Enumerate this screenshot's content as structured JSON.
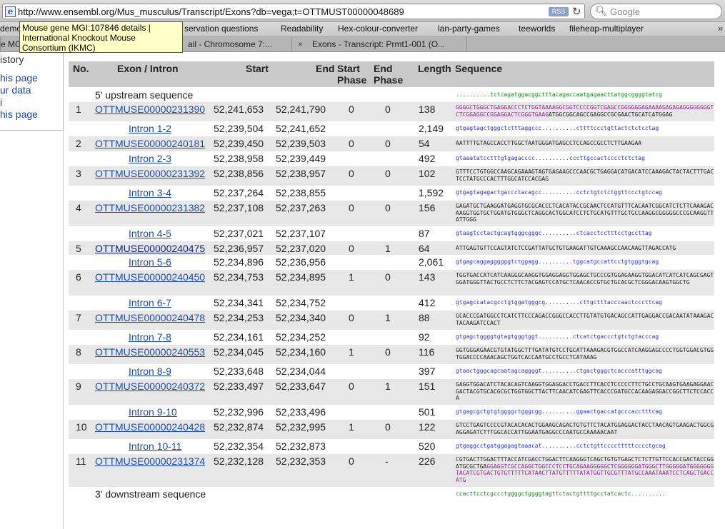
{
  "browser": {
    "url": "http://www.ensembl.org/Mus_musculus/Transcript/Exons?db=vega;t=OTTMUST00000048689",
    "rss_label": "RSS",
    "search_placeholder": "Google"
  },
  "bookmarks": [
    {
      "label": "demo"
    },
    {
      "label": "servation questions"
    },
    {
      "label": "Readability"
    },
    {
      "label": "Hex-colour-converter"
    },
    {
      "label": "lan-party-games"
    },
    {
      "label": "teeworlds"
    },
    {
      "label": "fileheap-multiplayer"
    }
  ],
  "tabs": [
    {
      "label": "e MG"
    },
    {
      "label": "ail - Chromosome 7:..."
    },
    {
      "label": "Exons - Transcript: Prmt1-001 (O..."
    }
  ],
  "tooltip": "Mouse gene MGI:107846 details | International Knockout Mouse Consortium (IKMC)",
  "sidebar": {
    "items": [
      "istory",
      "his page",
      "ur data",
      "his page"
    ]
  },
  "table": {
    "headers": {
      "no": "No.",
      "exon": "Exon / Intron",
      "start": "Start",
      "end": "End",
      "start_phase": "Start Phase",
      "end_phase": "End Phase",
      "length": "Length",
      "sequence": "Sequence"
    },
    "rows": [
      {
        "type": "flank",
        "label": "5' upstream sequence",
        "seq": [
          {
            "c": "gr",
            "t": "..........tctcagatggacggctttacagaccaatgagaacttatggcggggtatcg"
          }
        ]
      },
      {
        "type": "exon",
        "no": "1",
        "id": "OTTMUSE00000231390",
        "start": "52,241,653",
        "end": "52,241,790",
        "sp": "0",
        "ep": "0",
        "len": "138",
        "seq": [
          {
            "c": "pu",
            "t": "GGGGCTGGGCTGAGGACCCTCTGGTAAAAGGCGGTCCCCGGTCGAGCCGGGGGGAGAAAAGAGAGAGGGGGGGGTCTCGGAGGCCGGAGGACTCGGGTGAAG"
          },
          {
            "c": "bk",
            "t": "ATGGCGGCAGCCGAGGCCGCGAACTGCATCATGGAG"
          }
        ]
      },
      {
        "type": "intron",
        "label": "Intron 1-2",
        "start": "52,239,504",
        "end": "52,241,652",
        "len": "2,149",
        "seq": [
          {
            "c": "b",
            "t": "gtgagtagctgggctctttaggccc..........cttttccctgttactctctcctag"
          }
        ]
      },
      {
        "type": "exon",
        "no": "2",
        "id": "OTTMUSE00000240181",
        "start": "52,239,450",
        "end": "52,239,503",
        "sp": "0",
        "ep": "0",
        "len": "54",
        "seq": [
          {
            "c": "bk",
            "t": "AATTTTGTAGCCACCTTGGCTAATGGGATGAGCCTCCAGCCGCCTCTTGAAGAA"
          }
        ]
      },
      {
        "type": "intron",
        "label": "Intron 2-3",
        "start": "52,238,958",
        "end": "52,239,449",
        "len": "492",
        "seq": [
          {
            "c": "b",
            "t": "gtaaatatcctttgtgagacccc..........cccttgccactcccctctctag"
          }
        ]
      },
      {
        "type": "exon",
        "no": "3",
        "id": "OTTMUSE00000231392",
        "start": "52,238,856",
        "end": "52,238,957",
        "sp": "0",
        "ep": "0",
        "len": "102",
        "seq": [
          {
            "c": "bk",
            "t": "GTTTCCTGTGGCCAAGCAGAAAGTAGTGAGAAGCCCAACGCTGAGGACATGACATCCAAAGACTACTACTTTGACTCCTATGCCCACTTTGGCATCCACGAG"
          }
        ]
      },
      {
        "type": "intron",
        "label": "Intron 3-4",
        "start": "52,237,264",
        "end": "52,238,855",
        "len": "1,592",
        "seq": [
          {
            "c": "b",
            "t": "gtgagtagagactgaccctacagcc..........cctctgtctctggttccctgtccag"
          }
        ]
      },
      {
        "type": "exon",
        "no": "4",
        "id": "OTTMUSE00000231382",
        "start": "52,237,108",
        "end": "52,237,263",
        "sp": "0",
        "ep": "0",
        "len": "156",
        "seq": [
          {
            "c": "bk",
            "t": "GAGATGCTGAAGGATGAGGTGCGCACCCTCACATACCGCAACTCCATGTTTCACAATCGGCATCTCTTCAAAGACAAGGTGGTGCTGGATGTGGGCTCAGGCACTGGCATCCTCTGCATGTTTGCTGCCAAGGCGGGGGCCCGCAAGGTTATTGGG"
          }
        ]
      },
      {
        "type": "intron",
        "label": "Intron 4-5",
        "start": "52,237,021",
        "end": "52,237,107",
        "len": "87",
        "seq": [
          {
            "c": "b",
            "t": "gtaagtcctactgcagtgggcgggc..........ctcacctcctttcctgccttag"
          }
        ]
      },
      {
        "type": "exon",
        "no": "5",
        "id": "OTTMUSE00000240475",
        "dark": true,
        "start": "52,236,957",
        "end": "52,237,020",
        "sp": "0",
        "ep": "1",
        "len": "64",
        "seq": [
          {
            "c": "bk",
            "t": "ATTGAGTGTTCCAGTATCTCCGATTATGCTGTGAAGATTGTCAAAGCCAACAAGTTAGACCATG"
          }
        ]
      },
      {
        "type": "intron",
        "label": "Intron 5-6",
        "start": "52,234,896",
        "end": "52,236,956",
        "len": "2,061",
        "seq": [
          {
            "c": "b",
            "t": "gtgagcaggaggggggtctggagg..........tggcatgccattcctgtgggtgcag"
          }
        ]
      },
      {
        "type": "exon",
        "no": "6",
        "id": "OTTMUSE00000240450",
        "start": "52,234,753",
        "end": "52,234,895",
        "sp": "1",
        "ep": "0",
        "len": "143",
        "seq": [
          {
            "c": "bk",
            "t": "TGGTGACCATCATCAAGGGCAAGGTGGAGGAGGTGGAGCTGCCCGTGGAGAAGGTGGACATCATCATCAGCGAGTGGATGGGTTACTGCCTCTTCTACGAGTCCATGCTCAACACCGTGCTGCACGCTCGGGACAAGTGGCTG"
          }
        ]
      },
      {
        "type": "intron",
        "label": "Intron 6-7",
        "start": "52,234,341",
        "end": "52,234,752",
        "len": "412",
        "seq": [
          {
            "c": "b",
            "t": "gtgagccatacgcctgtggatgggcg..........cttgctttacccaactcccttcag"
          }
        ]
      },
      {
        "type": "exon",
        "no": "7",
        "id": "OTTMUSE00000240478",
        "start": "52,234,253",
        "end": "52,234,340",
        "sp": "0",
        "ep": "1",
        "len": "88",
        "seq": [
          {
            "c": "bk",
            "t": "GCACCCGATGGCCTCATCTTCCCAGACCGGGCCACCTTGTATGTGACAGCCATTGAGGACCGACAATATAAAGACTACAAGATCCACT"
          }
        ]
      },
      {
        "type": "intron",
        "label": "Intron 7-8",
        "start": "52,234,161",
        "end": "52,234,252",
        "len": "92",
        "seq": [
          {
            "c": "b",
            "t": "gtgagctggggtgtagtgggtggt..........ctcatctgaccctgtctgtacccag"
          }
        ]
      },
      {
        "type": "exon",
        "no": "8",
        "id": "OTTMUSE00000240553",
        "start": "52,234,045",
        "end": "52,234,160",
        "sp": "1",
        "ep": "0",
        "len": "116",
        "seq": [
          {
            "c": "bk",
            "t": "GGTGGGAGAACGTGTATGGCTTTGATATGTCCTGCATTAAAGACGTGGCCATCAAGGAGCCCCTGGTGGACGTGGTGGACCCCAAACAGCTGGTCACCAATGCCTGCCTCATAAAG"
          }
        ]
      },
      {
        "type": "intron",
        "label": "Intron 8-9",
        "start": "52,233,648",
        "end": "52,234,044",
        "len": "397",
        "seq": [
          {
            "c": "b",
            "t": "gtaactgggcagcaatagcaggggt..........ctgactgggctcacccatttggcag"
          }
        ]
      },
      {
        "type": "exon",
        "no": "9",
        "id": "OTTMUSE00000240372",
        "start": "52,233,497",
        "end": "52,233,647",
        "sp": "0",
        "ep": "1",
        "len": "151",
        "seq": [
          {
            "c": "bk",
            "t": "GAGGTGGACATCTACACAGTCAAGGTGGAGGACCTGACCTTCACCTCCCCCTTCTGCCTGCAAGTGAAGAGGAACGACTACGTGCACGCGCTGGTGGCTTACTTCAACATCGAGTTCACCCGATGCCACAAGAGGACCGGCTTCTCCACCA"
          }
        ]
      },
      {
        "type": "intron",
        "label": "Intron 9-10",
        "start": "52,232,996",
        "end": "52,233,496",
        "len": "501",
        "seq": [
          {
            "c": "b",
            "t": "gtgagcgctgtgtggggctgggcgg..........ggaactgaccatgcccacctttcag"
          }
        ]
      },
      {
        "type": "exon",
        "no": "10",
        "id": "OTTMUSE00000240428",
        "start": "52,232,874",
        "end": "52,232,995",
        "sp": "1",
        "ep": "0",
        "len": "122",
        "seq": [
          {
            "c": "bk",
            "t": "GTCCTGAGTCCCCGTACACACACTGGAAGCAGACTGTGTTCTACATGGAGGACTACCTAACAGTGAAGACTGGCGAGGAGATCTTTGGCACCATTGGAATGAGGCCCAATGCCAAAAACAAT"
          }
        ]
      },
      {
        "type": "intron",
        "label": "Intron 10-11",
        "start": "52,232,354",
        "end": "52,232,873",
        "len": "520",
        "seq": [
          {
            "c": "b",
            "t": "gtgaggcctgatggagagtaaacat..........cctctgttcccctttttcccctgcag"
          }
        ]
      },
      {
        "type": "exon",
        "no": "11",
        "id": "OTTMUSE00000231374",
        "start": "52,232,128",
        "end": "52,232,353",
        "sp": "0",
        "ep": "-",
        "len": "226",
        "seq": [
          {
            "c": "bk",
            "t": "CGTGACTTGGACTTTACCATCGACCTGGACTTCAAGGGTCAGCTGTGTGAGCTCTCTTGTTCCACCGACTACCGGATGCGCTGA"
          },
          {
            "c": "pu",
            "t": "GGAGGTCGCCAGGCTGGCCCTCCTGCAGAAGGGGGCTCGGGGGGATGGGCTTGGGGGATGGGGGGGTACATCGTGACTGTGTTTTTCATAACTTATGTTTTTATATGGTTGCGTTTATGCCAAATAAATCCTCAGCTGACCATG"
          }
        ]
      },
      {
        "type": "flank",
        "label": "3' downstream sequence",
        "seq": [
          {
            "c": "gr",
            "t": "ccacttcctcgccctggggctggggtagttctactgttttgcctatcactc.........."
          }
        ]
      }
    ]
  }
}
